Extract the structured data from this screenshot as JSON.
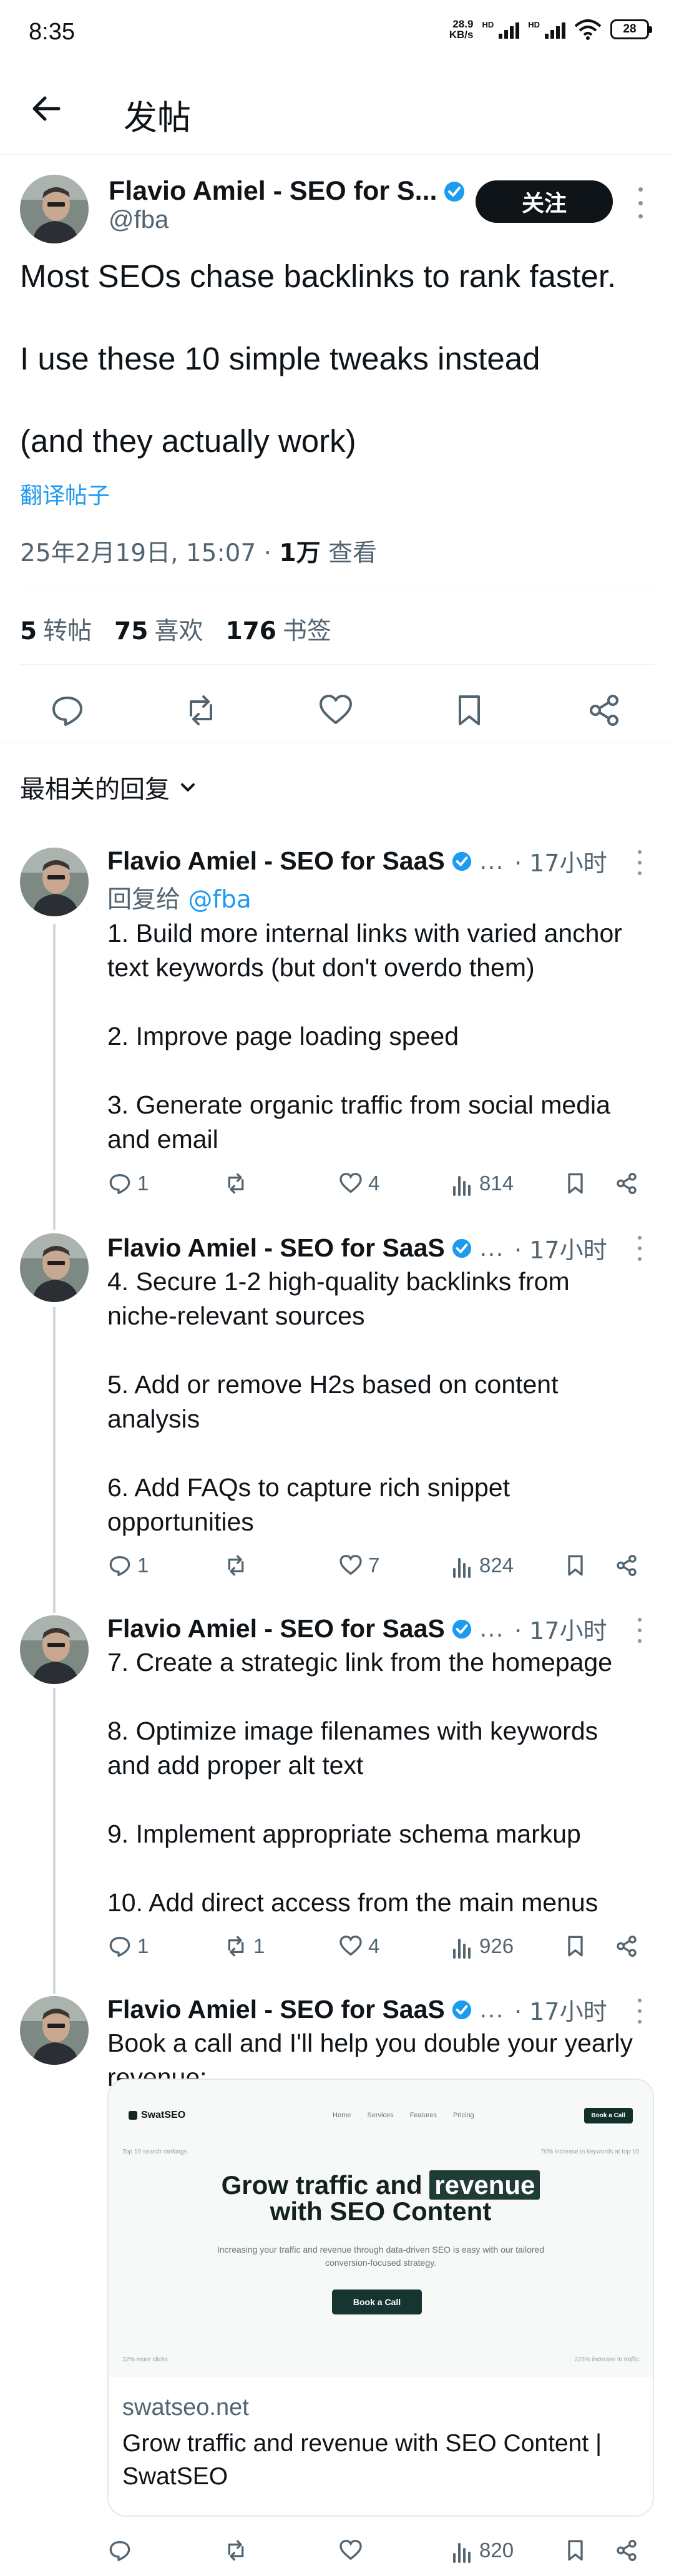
{
  "status_bar": {
    "time": "8:35",
    "net_speed_value": "28.9",
    "net_speed_unit": "KB/s",
    "battery": "28"
  },
  "header": {
    "title": "发帖"
  },
  "post": {
    "author_name": "Flavio Amiel - SEO for S...",
    "handle": "@fba",
    "follow_label": "关注",
    "text": "Most SEOs chase backlinks to rank faster.\n\nI use these 10 simple tweaks instead\n\n(and they actually work)",
    "translate_label": "翻译帖子",
    "timestamp": "25年2月19日, 15:07 · ",
    "views_count": "1万",
    "views_label": " 查看",
    "stats": {
      "reposts_count": "5",
      "reposts_label": "转帖",
      "likes_count": "75",
      "likes_label": "喜欢",
      "bookmarks_count": "176",
      "bookmarks_label": "书签"
    }
  },
  "sort": {
    "label": "最相关的回复"
  },
  "replies": [
    {
      "author_name": "Flavio Amiel - SEO for SaaS",
      "ellipsis": "...",
      "time": "· 17小时",
      "reply_to_prefix": "回复给 ",
      "reply_to_handle": "@fba",
      "text": "1. Build more internal links with varied anchor text keywords (but don't overdo them)\n\n2. Improve page loading speed\n\n3. Generate organic traffic from social media and email",
      "replies": "1",
      "reposts": "",
      "likes": "4",
      "views": "814"
    },
    {
      "author_name": "Flavio Amiel - SEO for SaaS",
      "ellipsis": "...",
      "time": "· 17小时",
      "text": "4. Secure 1-2 high-quality backlinks from niche-relevant sources\n\n5. Add or remove H2s based on content analysis\n\n6. Add FAQs to capture rich snippet opportunities",
      "replies": "1",
      "reposts": "",
      "likes": "7",
      "views": "824"
    },
    {
      "author_name": "Flavio Amiel - SEO for SaaS",
      "ellipsis": "...",
      "time": "· 17小时",
      "text": "7. Create a strategic link from the homepage\n\n8. Optimize image filenames with keywords and add proper alt text\n\n9. Implement appropriate schema markup\n\n10. Add direct access from the main menus",
      "replies": "1",
      "reposts": "1",
      "likes": "4",
      "views": "926"
    },
    {
      "author_name": "Flavio Amiel - SEO for SaaS",
      "ellipsis": "...",
      "time": "· 17小时",
      "text": "Book a call and I'll help you double your yearly revenue:",
      "replies": "",
      "reposts": "",
      "likes": "",
      "views": "820",
      "card": {
        "site_logo": "SwatSEO",
        "nav": [
          "Home",
          "Services",
          "Features",
          "Pricing"
        ],
        "nav_cta": "Book a Call",
        "corner_tl": "Top 10 search rankings",
        "corner_tr": "70% increase in keywords at top 10",
        "corner_bl": "32% more clicks",
        "corner_br": "225% increase in traffic",
        "hero_title_part1": "Grow traffic and ",
        "hero_title_highlight": "revenue",
        "hero_title_part2": "with SEO Content",
        "hero_sub": "Increasing your traffic and revenue through data-driven SEO is easy with our tailored conversion-focused strategy.",
        "hero_button": "Book a Call",
        "domain": "swatseo.net",
        "title": "Grow traffic and revenue with SEO Content | SwatSEO"
      }
    }
  ],
  "colors": {
    "accent": "#1d9bf0",
    "text": "#0f1419",
    "muted": "#536471",
    "thread_line": "#cfd9de"
  },
  "icons": [
    "back-arrow-icon",
    "verified-badge-icon",
    "more-vertical-icon",
    "reply-icon",
    "repost-icon",
    "like-icon",
    "bookmark-icon",
    "share-icon",
    "views-icon",
    "chevron-down-icon",
    "wifi-icon",
    "signal-icon"
  ]
}
